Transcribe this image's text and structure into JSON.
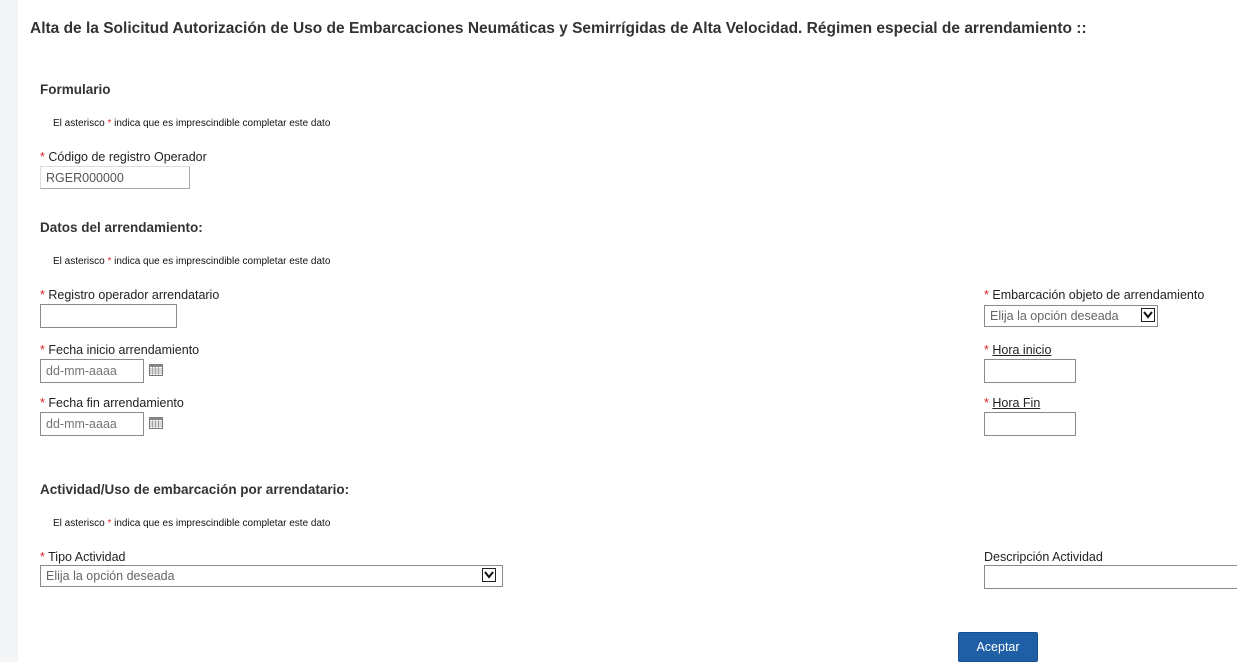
{
  "page": {
    "title": "Alta de la Solicitud Autorización de Uso de Embarcaciones Neumáticas y Semirrígidas de Alta Velocidad. Régimen especial de arrendamiento ::"
  },
  "required_note": {
    "prefix": "El asterisco ",
    "asterisk": "*",
    "suffix": " indica que es imprescindible completar este dato"
  },
  "form": {
    "section_title": "Formulario",
    "codigo": {
      "label": "Código de registro Operador",
      "value": "RGER000000"
    }
  },
  "arrendamiento": {
    "section_title": "Datos del arrendamiento:",
    "registro_arrendatario": {
      "label": "Registro operador arrendatario",
      "value": ""
    },
    "embarcacion": {
      "label": "Embarcación objeto de arrendamiento",
      "selected": "Elija la opción deseada"
    },
    "fecha_inicio": {
      "label": "Fecha inicio arrendamiento",
      "placeholder": "dd-mm-aaaa"
    },
    "hora_inicio": {
      "label": "Hora inicio",
      "value": ""
    },
    "fecha_fin": {
      "label": "Fecha fin arrendamiento",
      "placeholder": "dd-mm-aaaa"
    },
    "hora_fin": {
      "label": "Hora Fin",
      "value": ""
    }
  },
  "actividad": {
    "section_title": "Actividad/Uso de embarcación por arrendatario:",
    "tipo": {
      "label": "Tipo Actividad",
      "selected": "Elija la opción deseada"
    },
    "descripcion": {
      "label": "Descripción Actividad",
      "value": ""
    }
  },
  "actions": {
    "accept_label": "Aceptar"
  },
  "icons": {
    "calendar": "calendar-icon",
    "select_arrow": "chevron-down-icon"
  }
}
